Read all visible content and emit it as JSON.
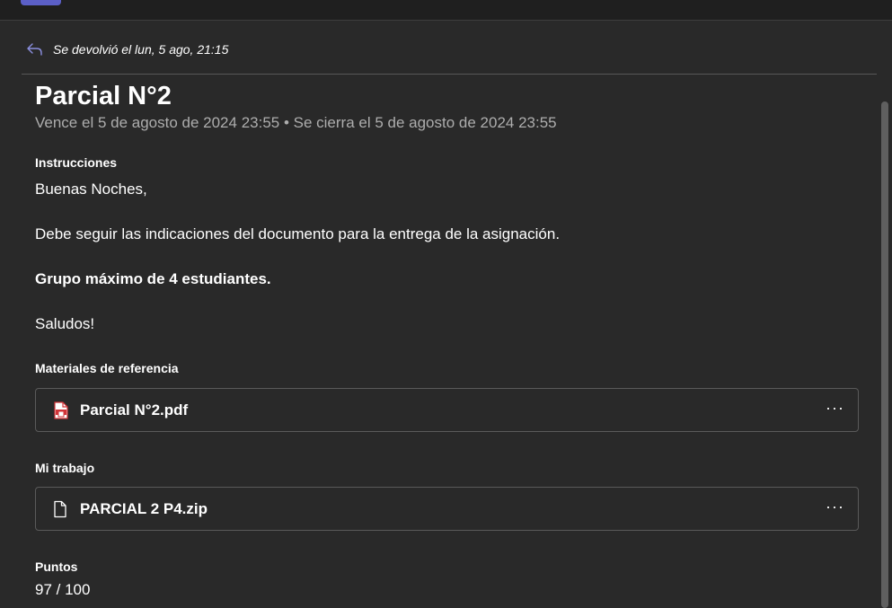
{
  "status": {
    "returned_text": "Se devolvió el lun, 5 ago, 21:15"
  },
  "assignment": {
    "title": "Parcial N°2",
    "due_line": "Vence el 5 de agosto de 2024 23:55 • Se cierra el 5 de agosto de 2024 23:55"
  },
  "instructions": {
    "label": "Instrucciones",
    "greeting": "Buenas Noches,",
    "body": "Debe seguir las indicaciones del documento para la entrega de la asignación.",
    "group_note": "Grupo máximo de 4 estudiantes.",
    "closing": "Saludos!"
  },
  "reference": {
    "label": "Materiales de referencia",
    "file_name": "Parcial N°2.pdf",
    "file_icon": "pdf-file-icon"
  },
  "my_work": {
    "label": "Mi trabajo",
    "file_name": "PARCIAL 2 P4.zip",
    "file_icon": "generic-file-icon"
  },
  "points": {
    "label": "Puntos",
    "value": "97 / 100"
  },
  "more_glyph": "···",
  "colors": {
    "accent": "#5b5fc7",
    "pdf_red": "#d13438",
    "background": "#292929"
  }
}
